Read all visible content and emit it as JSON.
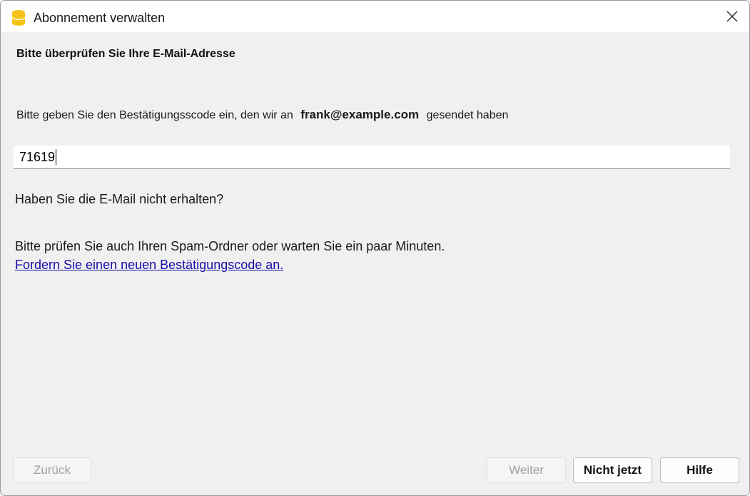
{
  "window": {
    "title": "Abonnement verwalten",
    "app_icon": "database-icon",
    "close_icon": "close-icon"
  },
  "main": {
    "heading": "Bitte überprüfen Sie Ihre E-Mail-Adresse",
    "instruction_before": "Bitte geben Sie den Bestätigungsscode ein, den wir an",
    "email": "frank@example.com",
    "instruction_after": "gesendet haben",
    "code_value": "71619",
    "not_received": "Haben Sie die E-Mail nicht erhalten?",
    "spam_hint": "Bitte prüfen Sie auch Ihren Spam-Ordner oder warten Sie ein paar Minuten.",
    "resend_link": "Fordern Sie einen neuen Bestätigungscode an."
  },
  "buttons": {
    "back": "Zurück",
    "next": "Weiter",
    "not_now": "Nicht jetzt",
    "help": "Hilfe"
  },
  "colors": {
    "app_icon": "#f5c318",
    "link": "#1a0dab",
    "window_bg": "#f0f0f0"
  }
}
